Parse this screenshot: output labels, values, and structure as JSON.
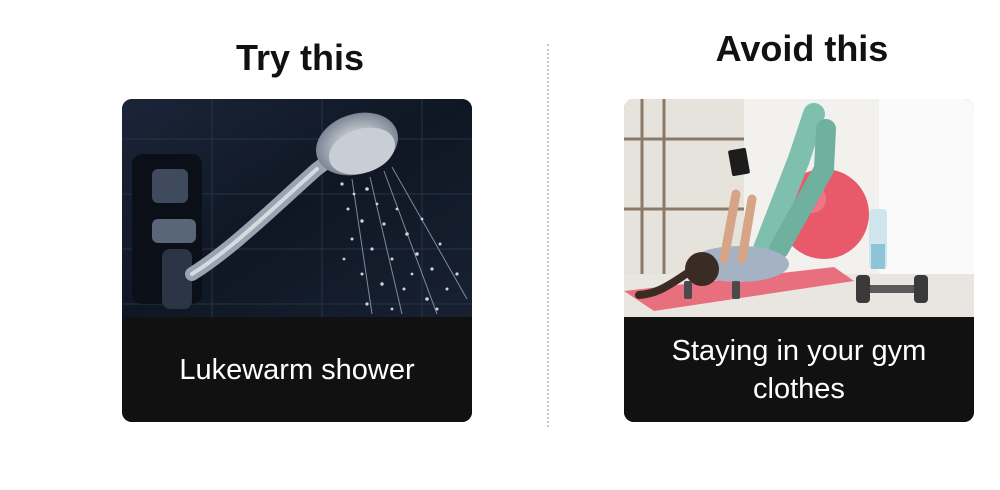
{
  "left": {
    "heading": "Try this",
    "image": "shower-head-spraying-water",
    "caption": "Lukewarm shower"
  },
  "right": {
    "heading": "Avoid this",
    "image": "woman-lying-on-yoga-mat-with-phone",
    "caption": "Staying in your gym clothes"
  }
}
